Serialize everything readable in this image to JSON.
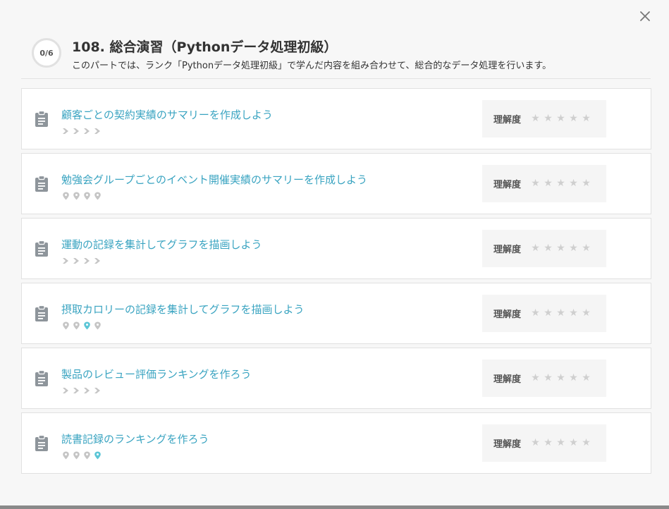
{
  "section": {
    "progress": "0/6",
    "title": "108. 総合演習（Pythonデータ処理初級）",
    "description": "このパートでは、ランク「Pythonデータ処理初級」で学んだ内容を組み合わせて、総合的なデータ処理を行います。"
  },
  "rating_label": "理解度",
  "colors": {
    "accent": "#3aa4c1",
    "tag_gray": "#c5c5c5",
    "tag_active": "#5cc6d6",
    "star_empty": "#cfcfcf"
  },
  "lessons": [
    {
      "title": "顧客ごとの契約実績のサマリーを作成しよう",
      "tag_type": "chevron",
      "tags": [
        false,
        false,
        false,
        false
      ],
      "rating": 0
    },
    {
      "title": "勉強会グループごとのイベント開催実績のサマリーを作成しよう",
      "tag_type": "pin",
      "tags": [
        false,
        false,
        false,
        false
      ],
      "rating": 0
    },
    {
      "title": "運動の記録を集計してグラフを描画しよう",
      "tag_type": "chevron",
      "tags": [
        false,
        false,
        false,
        false
      ],
      "rating": 0
    },
    {
      "title": "摂取カロリーの記録を集計してグラフを描画しよう",
      "tag_type": "pin",
      "tags": [
        false,
        false,
        true,
        false
      ],
      "rating": 0
    },
    {
      "title": "製品のレビュー評価ランキングを作ろう",
      "tag_type": "chevron",
      "tags": [
        false,
        false,
        false,
        false
      ],
      "rating": 0
    },
    {
      "title": "読書記録のランキングを作ろう",
      "tag_type": "pin",
      "tags": [
        false,
        false,
        false,
        true
      ],
      "rating": 0
    }
  ],
  "icons": {
    "close": "close-icon",
    "lesson": "clipboard-icon",
    "chevron_tag": "chevron-right-icon",
    "pin_tag": "map-pin-icon",
    "star": "star-icon"
  }
}
